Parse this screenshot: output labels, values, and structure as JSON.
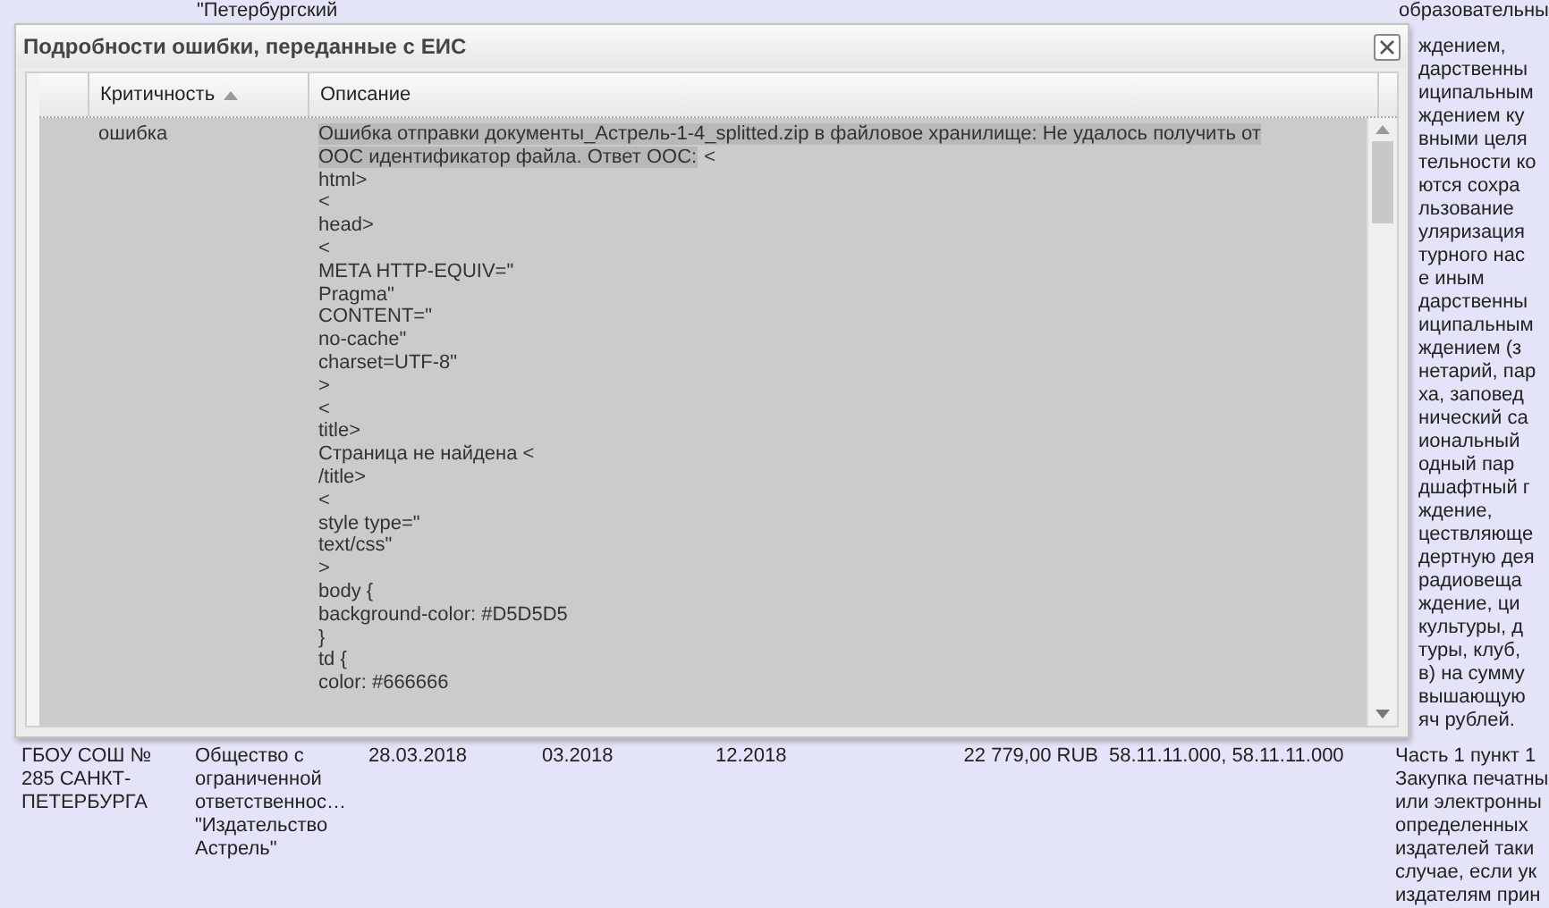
{
  "background_top": {
    "left_text": "\"Петербургский",
    "right_text": "образовательны"
  },
  "dialog": {
    "title": "Подробности ошибки, переданные с ЕИС",
    "grid": {
      "columns": [
        {
          "label": "Критичность",
          "sorted": true
        },
        {
          "label": "Описание",
          "sorted": false
        }
      ],
      "rows": [
        {
          "selected": true,
          "severity": "ошибка",
          "description": {
            "selection": "Ошибка отправки документы_Астрель-1-4_splitted.zip в файловое хранилище: Не удалось получить от ООС идентификатор файла. Ответ ООС:",
            "tail": "<",
            "lines": [
              "html>",
              "<",
              "head>",
              "<",
              "META HTTP-EQUIV=\"",
              "Pragma\"",
              "CONTENT=\"",
              "no-cache\"",
              "charset=UTF-8\"",
              ">",
              "<",
              "title>",
              "Страница не найдена <",
              "/title>",
              "<",
              "style type=\"",
              "text/css\"",
              ">",
              "body {",
              "background-color: #D5D5D5",
              "}",
              "td {",
              "color: #666666"
            ]
          }
        }
      ]
    }
  },
  "background_side_fragments": [
    "ждением,",
    "дарственны",
    "иципальным",
    "ждением ку",
    "вными целя",
    "тельности ко",
    "ются сохра",
    "льзование",
    "уляризация",
    "турного нас",
    "е иным",
    "дарственны",
    "иципальным",
    "ждением (з",
    "нетарий, пар",
    "ха, заповед",
    "нический са",
    "иональный",
    "одный пар",
    "дшафтный г",
    "ждение,",
    "цествляюще",
    "дертную дея",
    "радиовеща",
    "ждение, ци",
    "культуры, д",
    "туры, клуб,",
    "в) на сумму",
    "вышающую",
    "яч рублей."
  ],
  "background_row": {
    "cells": [
      {
        "kind": "text",
        "lines": [
          "ГБОУ СОШ №",
          "285 САНКТ-",
          "ПЕТЕРБУРГА"
        ]
      },
      {
        "kind": "text",
        "lines": [
          "Общество с",
          "ограниченной",
          "ответственнос…",
          "\"Издательство",
          "Астрель\""
        ]
      },
      {
        "kind": "text",
        "lines": [
          "28.03.2018"
        ]
      },
      {
        "kind": "text",
        "lines": [
          "03.2018"
        ]
      },
      {
        "kind": "text",
        "lines": [
          "12.2018"
        ]
      },
      {
        "kind": "amount",
        "lines": [
          "22 779,00 RUB"
        ]
      },
      {
        "kind": "text",
        "lines": [
          "58.11.11.000, 58.11.11.000"
        ]
      },
      {
        "kind": "text",
        "lines": [
          "Часть 1 пункт 1",
          "Закупка печатны",
          "или электронны",
          "определенных",
          "издателей таки",
          "случае, если ук",
          "издателям прин"
        ]
      }
    ]
  }
}
